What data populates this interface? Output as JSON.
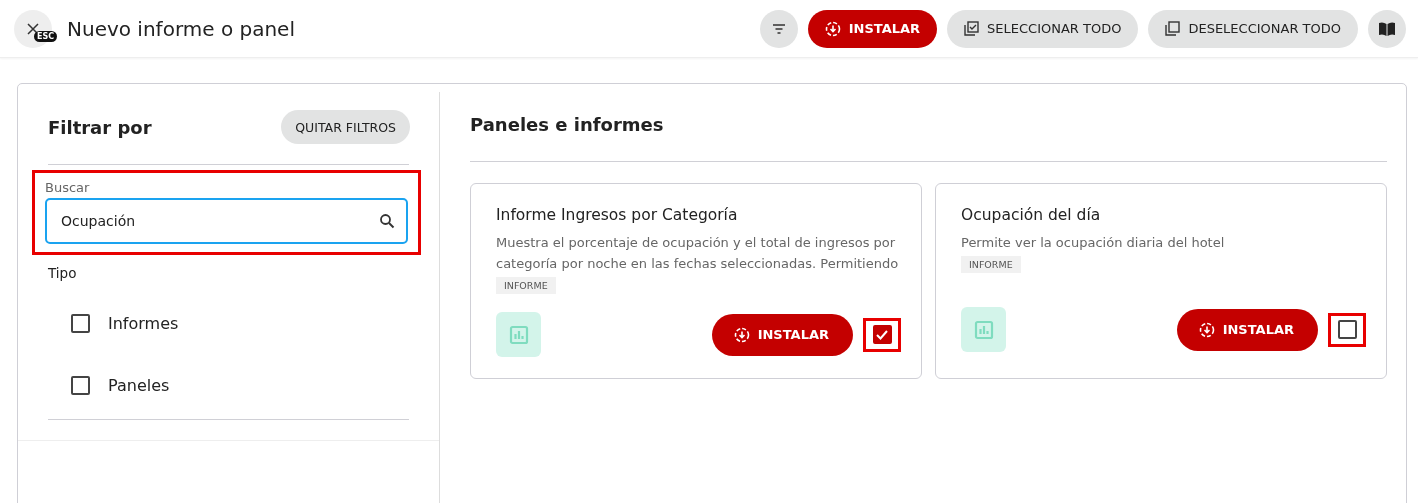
{
  "header": {
    "close_badge": "ESC",
    "title": "Nuevo informe o panel",
    "actions": [
      {
        "kind": "filter"
      },
      {
        "kind": "primary",
        "label": "INSTALAR"
      },
      {
        "kind": "select",
        "label": "SELECCIONAR TODO"
      },
      {
        "kind": "deselect",
        "label": "DESELECCIONAR TODO"
      },
      {
        "kind": "book"
      }
    ]
  },
  "filters": {
    "title": "Filtrar por",
    "clear_button": "QUITAR FILTROS",
    "search": {
      "label": "Buscar",
      "value": "Ocupación",
      "highlighted": true
    },
    "type_label": "Tipo",
    "options": [
      {
        "label": "Informes",
        "checked": false
      },
      {
        "label": "Paneles",
        "checked": false
      }
    ]
  },
  "content": {
    "title": "Paneles e informes",
    "cards": [
      {
        "title": "Informe Ingresos por Categoría",
        "description": "Muestra el porcentaje de ocupación y el total de ingresos por categoría por noche en las fechas seleccionadas. Permitiendo",
        "tag": "INFORME",
        "install": "INSTALAR",
        "checked": true,
        "highlighted": true
      },
      {
        "title": "Ocupación del día",
        "description": "Permite ver la ocupación diaria del hotel",
        "tag": "INFORME",
        "install": "INSTALAR",
        "checked": false,
        "highlighted": true
      }
    ]
  }
}
